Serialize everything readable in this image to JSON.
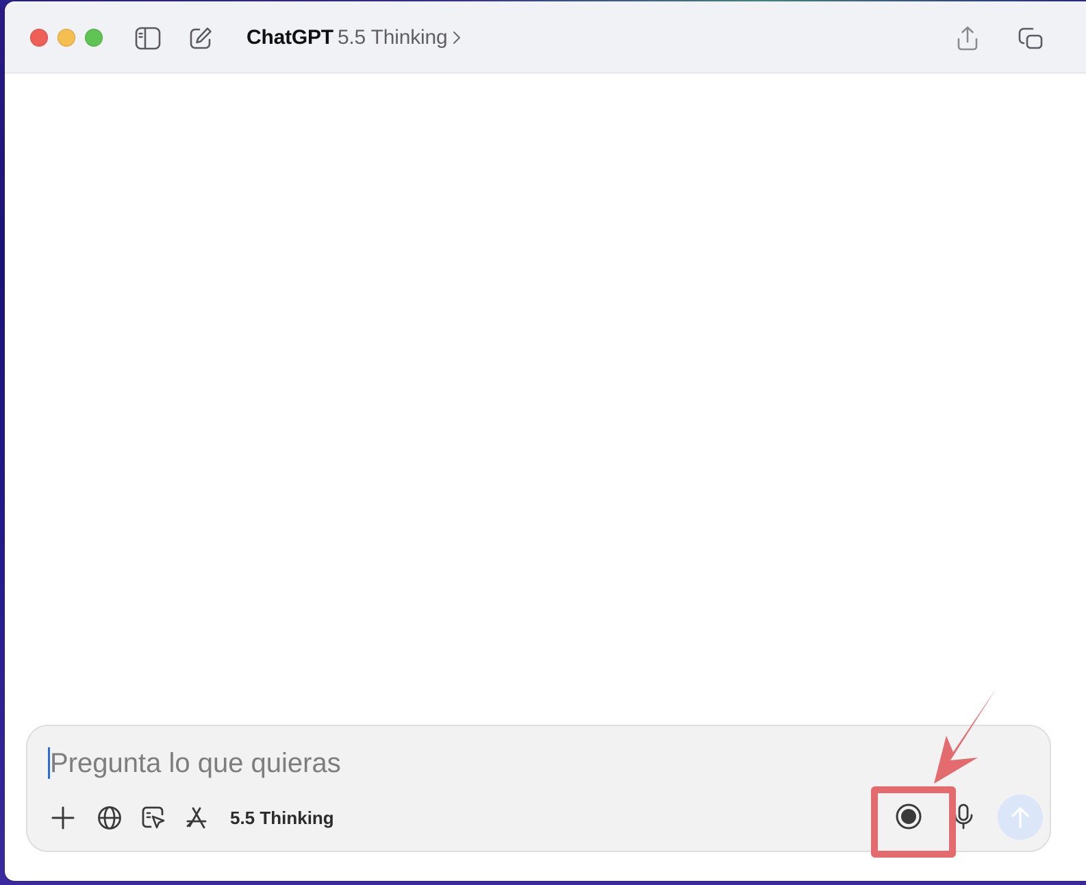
{
  "window": {
    "app_name": "ChatGPT",
    "model_name": "5.5 Thinking"
  },
  "titlebar": {
    "icons": [
      "close-window",
      "minimize-window",
      "maximize-window",
      "sidebar-toggle-icon",
      "new-chat-icon",
      "share-icon",
      "window-popout-icon"
    ]
  },
  "composer": {
    "placeholder": "Pregunta lo que quieras",
    "model_label": "5.5 Thinking",
    "icons": [
      "plus-icon",
      "globe-icon",
      "screen-select-icon",
      "app-store-icon",
      "record-icon",
      "microphone-icon",
      "send-arrow-icon"
    ]
  },
  "colors": {
    "titlebar_bg": "#f1f2f6",
    "composer_bg": "#f2f2f2",
    "send_button_bg": "#dbe6f8",
    "annotation": "#e36b6e",
    "caret": "#2a6ae0"
  }
}
